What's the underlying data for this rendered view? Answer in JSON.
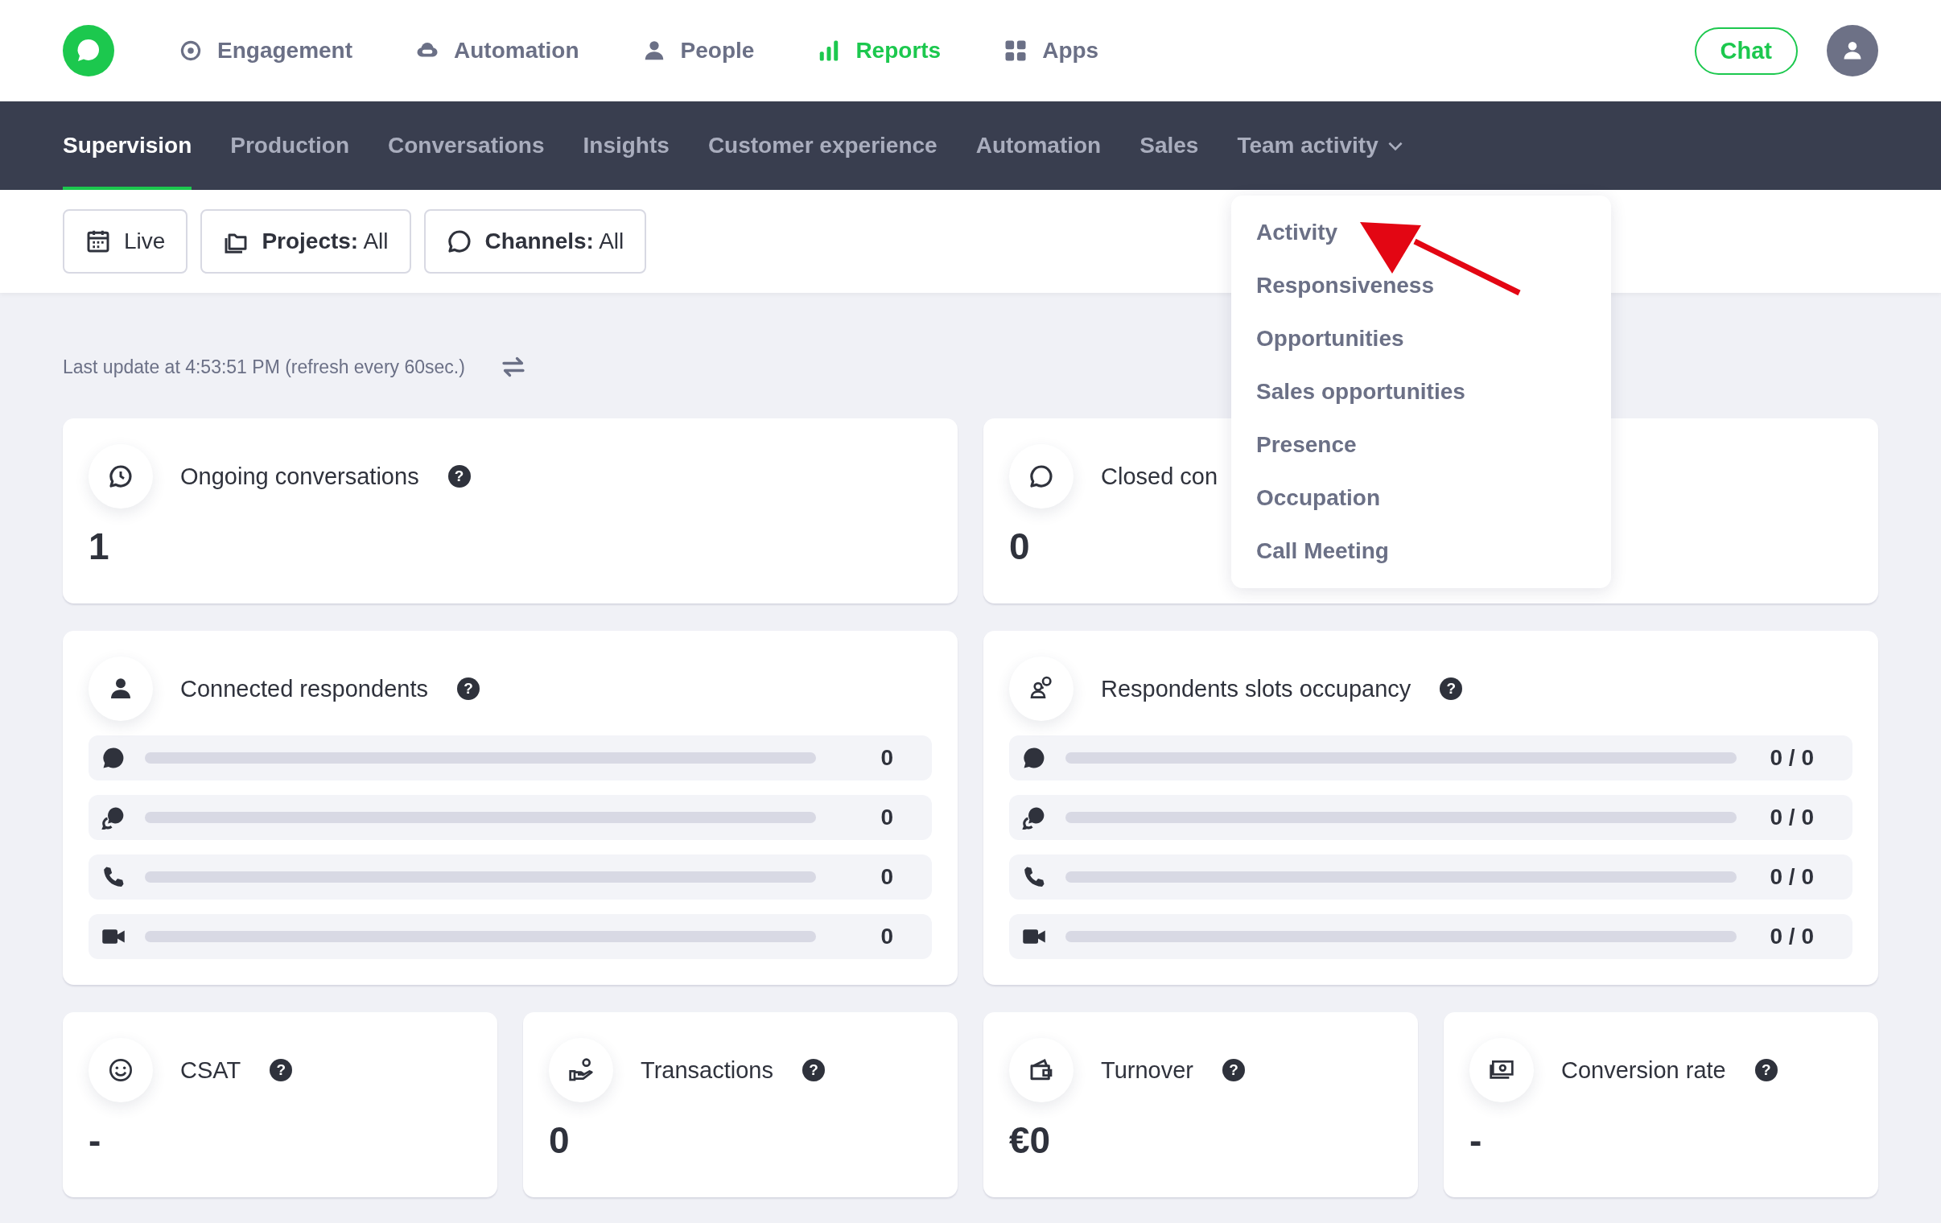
{
  "top_nav": {
    "items": [
      {
        "label": "Engagement",
        "selected": false
      },
      {
        "label": "Automation",
        "selected": false
      },
      {
        "label": "People",
        "selected": false
      },
      {
        "label": "Reports",
        "selected": true
      },
      {
        "label": "Apps",
        "selected": false
      }
    ],
    "chat_button": "Chat"
  },
  "sub_nav": {
    "tabs": [
      {
        "label": "Supervision",
        "selected": true
      },
      {
        "label": "Production",
        "selected": false
      },
      {
        "label": "Conversations",
        "selected": false
      },
      {
        "label": "Insights",
        "selected": false
      },
      {
        "label": "Customer experience",
        "selected": false
      },
      {
        "label": "Automation",
        "selected": false
      },
      {
        "label": "Sales",
        "selected": false
      },
      {
        "label": "Team activity",
        "selected": false,
        "expanded": true,
        "menu": [
          "Activity",
          "Responsiveness",
          "Opportunities",
          "Sales opportunities",
          "Presence",
          "Occupation",
          "Call Meeting"
        ]
      }
    ]
  },
  "filters": [
    {
      "label": "Live"
    },
    {
      "label": "**Projects:** All"
    },
    {
      "label": "**Channels:** All"
    }
  ],
  "last_update": "Last update at 4:53:51 PM (refresh every 60sec.)",
  "card_rows": [
    [
      {
        "kind": "metric",
        "title": "Ongoing conversations",
        "help": "?",
        "value": "1"
      },
      {
        "kind": "metric",
        "title": "Closed con",
        "value": "0"
      }
    ],
    [
      {
        "kind": "bars",
        "title": "Connected respondents",
        "help": "?",
        "rows": [
          {
            "kind": "chat",
            "value": "0"
          },
          {
            "kind": "chats",
            "value": "0"
          },
          {
            "kind": "phone",
            "value": "0"
          },
          {
            "kind": "video",
            "value": "0"
          }
        ]
      },
      {
        "kind": "bars",
        "title": "Respondents slots occupancy",
        "help": "?",
        "rows": [
          {
            "kind": "chat",
            "value": "0 / 0"
          },
          {
            "kind": "chats",
            "value": "0 / 0"
          },
          {
            "kind": "phone",
            "value": "0 / 0"
          },
          {
            "kind": "video",
            "value": "0 / 0"
          }
        ]
      }
    ],
    [
      {
        "kind": "metric",
        "title": "CSAT",
        "help": "?",
        "value": "-"
      },
      {
        "kind": "metric",
        "title": "Transactions",
        "help": "?",
        "value": "0"
      },
      {
        "kind": "metric",
        "title": "Turnover",
        "help": "?",
        "value": "€0"
      },
      {
        "kind": "metric",
        "title": "Conversion rate",
        "help": "?",
        "value": "-"
      }
    ]
  ]
}
